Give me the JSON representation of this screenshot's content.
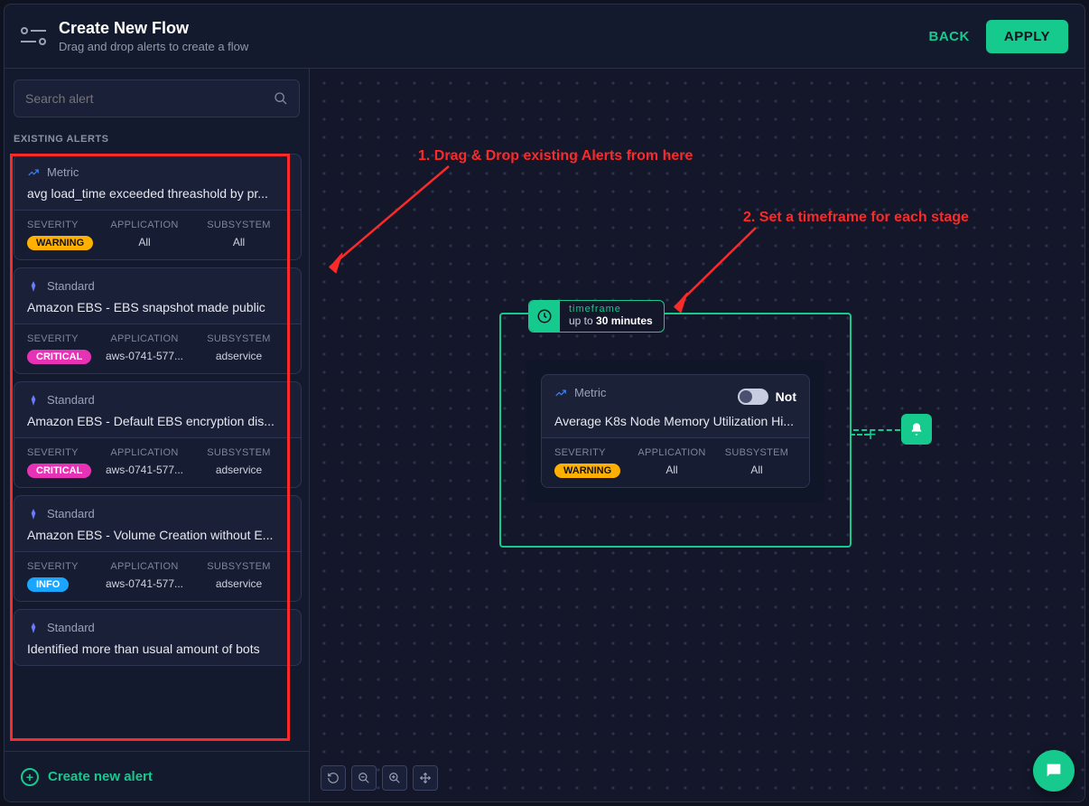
{
  "header": {
    "title": "Create New Flow",
    "subtitle": "Drag and drop alerts to create a flow",
    "back": "BACK",
    "apply": "APPLY"
  },
  "search": {
    "placeholder": "Search alert"
  },
  "section_label": "EXISTING ALERTS",
  "labels": {
    "severity": "SEVERITY",
    "application": "APPLICATION",
    "subsystem": "SUBSYSTEM",
    "all": "All"
  },
  "alerts": [
    {
      "type": "Metric",
      "title": "avg load_time exceeded threashold by pr...",
      "sev": "WARNING",
      "sev_class": "warning",
      "app": "All",
      "sub": "All"
    },
    {
      "type": "Standard",
      "title": "Amazon EBS - EBS snapshot made public",
      "sev": "CRITICAL",
      "sev_class": "critical",
      "app": "aws-0741-577...",
      "sub": "adservice"
    },
    {
      "type": "Standard",
      "title": "Amazon EBS - Default EBS encryption dis...",
      "sev": "CRITICAL",
      "sev_class": "critical",
      "app": "aws-0741-577...",
      "sub": "adservice"
    },
    {
      "type": "Standard",
      "title": "Amazon EBS - Volume Creation without E...",
      "sev": "INFO",
      "sev_class": "info",
      "app": "aws-0741-577...",
      "sub": "adservice"
    },
    {
      "type": "Standard",
      "title": "Identified more than usual amount of bots",
      "sev": "",
      "sev_class": "",
      "app": "",
      "sub": ""
    }
  ],
  "create_new": "Create new alert",
  "annotations": {
    "a1": "1. Drag & Drop existing Alerts from here",
    "a2": "2. Set a timeframe for each stage"
  },
  "stage": {
    "tf_label": "timeframe",
    "tf_prefix": "up to ",
    "tf_value": "30 minutes",
    "card": {
      "type": "Metric",
      "not": "Not",
      "title": "Average K8s Node Memory Utilization Hi...",
      "sev": "WARNING",
      "app": "All",
      "sub": "All"
    }
  }
}
